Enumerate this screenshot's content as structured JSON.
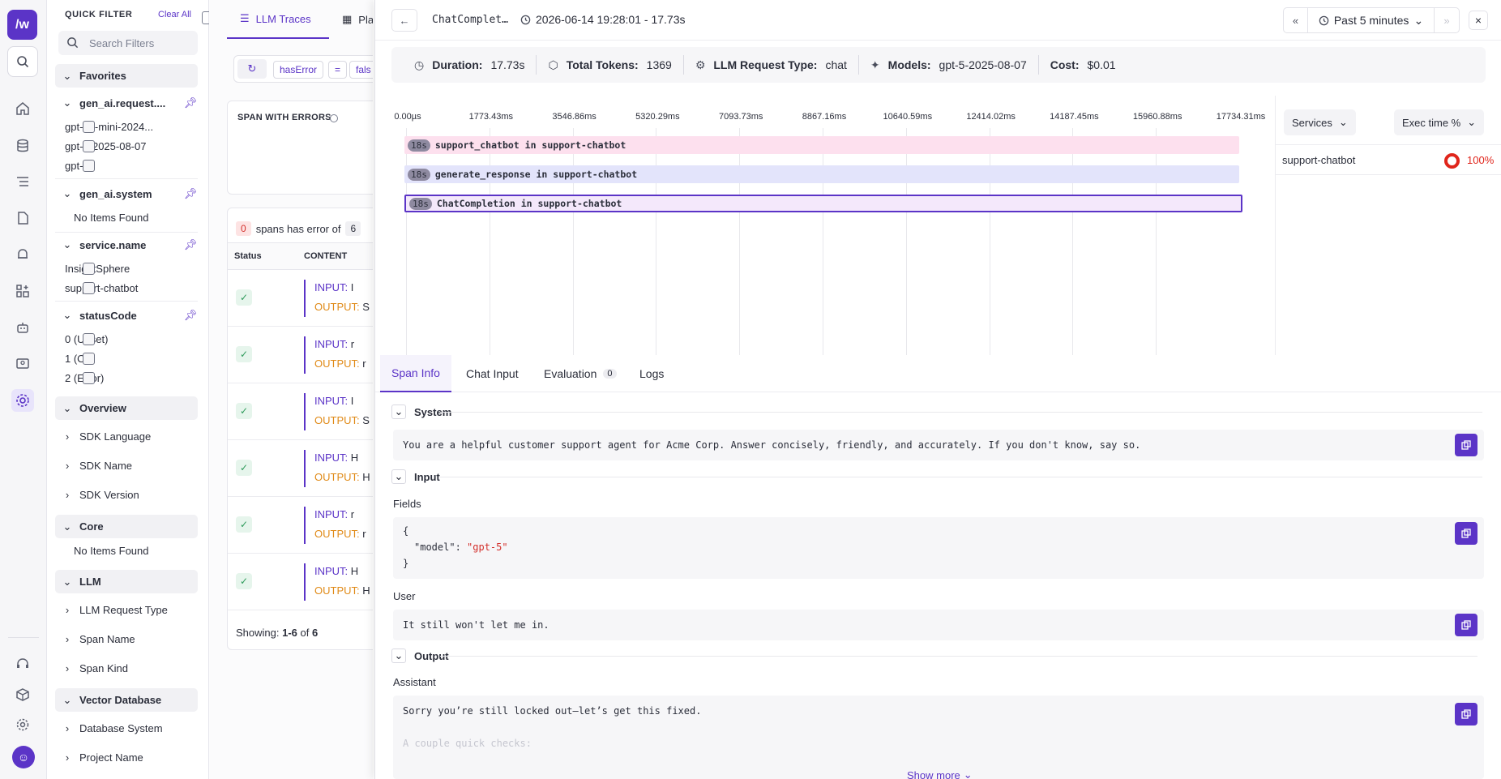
{
  "rail": {
    "logo": "/w",
    "icons": [
      "search-icon",
      "home-icon",
      "database-icon",
      "list-icon",
      "document-icon",
      "bell-icon",
      "dashboard-icon",
      "robot-icon",
      "monitor-user-icon",
      "settings-gear-icon",
      "support-icon",
      "cube-icon",
      "gear-icon"
    ]
  },
  "quick_filter": {
    "title": "QUICK FILTER",
    "clear_all": "Clear All",
    "search_placeholder": "Search Filters",
    "favorites": "Favorites",
    "gen_ai_request": "gen_ai.request....",
    "models": [
      "gpt-4o-mini-2024...",
      "gpt-5-2025-08-07",
      "gpt-5o"
    ],
    "gen_ai_system": "gen_ai.system",
    "no_items_1": "No Items Found",
    "service_name": "service.name",
    "services": [
      "InsightSphere",
      "support-chatbot"
    ],
    "status_code": "statusCode",
    "status_codes": [
      "0 (Unset)",
      "1 (Ok)",
      "2 (Error)"
    ],
    "overview": "Overview",
    "overview_items": [
      "SDK Language",
      "SDK Name",
      "SDK Version"
    ],
    "core": "Core",
    "no_items_2": "No Items Found",
    "llm": "LLM",
    "llm_items": [
      "LLM Request Type",
      "Span Name",
      "Span Kind"
    ],
    "vector_db": "Vector Database",
    "vector_items": [
      "Database System",
      "Project Name"
    ]
  },
  "list_panel": {
    "tab_traces": "LLM Traces",
    "tab_play": "Pla",
    "query_key": "hasError",
    "query_op": "=",
    "query_val": "fals",
    "card_title": "SPAN WITH ERRORS",
    "summary_count": "0",
    "summary_text": "spans has error of",
    "summary_total": "6",
    "col_status": "Status",
    "col_content": "CONTENT",
    "input_label": "INPUT:",
    "output_label": "OUTPUT:",
    "rows_in": [
      "I",
      "r",
      "I",
      "H",
      "r",
      "H"
    ],
    "rows_out": [
      "S",
      "r",
      "S",
      "H",
      "r",
      "H"
    ],
    "footer_prefix": "Showing: ",
    "footer_range": "1-6",
    "footer_mid": " of ",
    "footer_total": "6"
  },
  "drawer": {
    "title": "ChatComplet…",
    "timestamp": "2026-06-14 19:28:01 - 17.73s",
    "time_range": "Past 5 minutes",
    "close": "×",
    "stats": {
      "duration_label": "Duration:",
      "duration": "17.73s",
      "tokens_label": "Total Tokens:",
      "tokens": "1369",
      "reqtype_label": "LLM Request Type:",
      "reqtype": "chat",
      "models_label": "Models:",
      "models": "gpt-5-2025-08-07",
      "cost_label": "Cost:",
      "cost": "$0.01"
    },
    "ticks": [
      "0.00µs",
      "1773.43ms",
      "3546.86ms",
      "5320.29ms",
      "7093.73ms",
      "8867.16ms",
      "10640.59ms",
      "12414.02ms",
      "14187.45ms",
      "15960.88ms",
      "17734.31ms"
    ],
    "spans": [
      {
        "badge": "18s",
        "name": "support_chatbot in support-chatbot",
        "color": "#fde0ee"
      },
      {
        "badge": "18s",
        "name": "generate_response in support-chatbot",
        "color": "#e3e4fb"
      },
      {
        "badge": "18s",
        "name": "ChatCompletion in support-chatbot",
        "color": "#f4e8fb"
      }
    ],
    "services_dd": "Services",
    "exec_dd": "Exec time %",
    "service_row": "support-chatbot",
    "service_pct": "100%",
    "tabs": {
      "span_info": "Span Info",
      "chat_input": "Chat Input",
      "evaluation": "Evaluation",
      "eval_count": "0",
      "logs": "Logs"
    },
    "system_label": "System",
    "system_text": "You are a helpful customer support agent for Acme Corp. Answer concisely, friendly, and accurately. If you don't know, say so.",
    "input_label": "Input",
    "fields_label": "Fields",
    "json_open": "{",
    "json_key": "\"model\"",
    "json_colon": ": ",
    "json_val": "\"gpt-5\"",
    "json_close": "}",
    "user_label": "User",
    "user_text": "It still won't let me in.",
    "output_label": "Output",
    "assistant_label": "Assistant",
    "assistant_text": "Sorry you’re still locked out—let’s get this fixed.",
    "assistant_more": "A couple quick checks:",
    "show_more": "Show more"
  }
}
